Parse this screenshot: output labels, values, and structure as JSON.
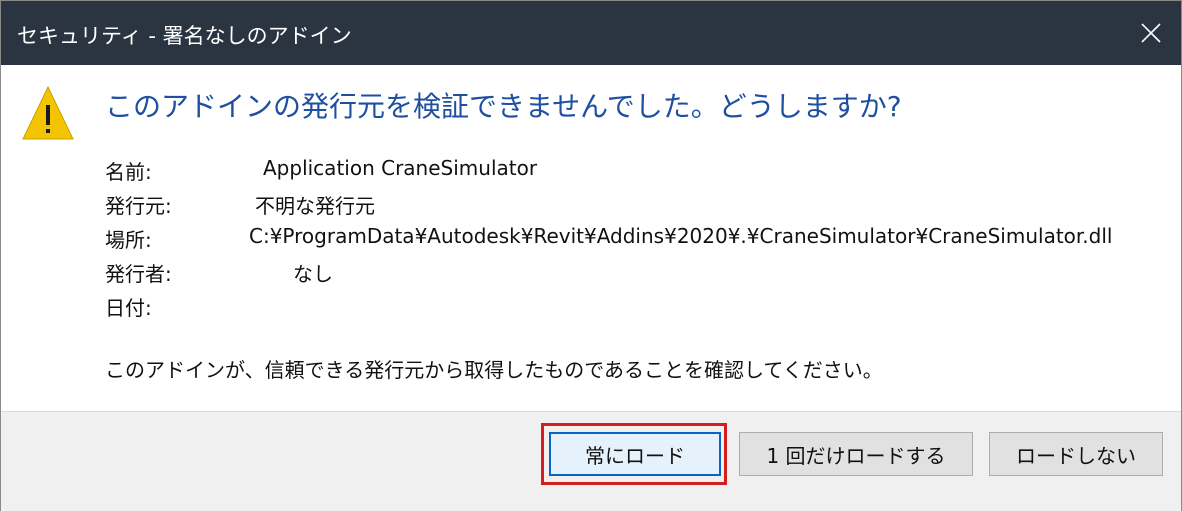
{
  "window": {
    "title": "セキュリティ - 署名なしのアドイン",
    "close_icon": "close-icon"
  },
  "warning_icon": "warning-triangle-icon",
  "headline": "このアドインの発行元を検証できませんでした。どうしますか?",
  "details": {
    "name_label": "名前:",
    "name_value": "Application CraneSimulator",
    "publisher_label": "発行元:",
    "publisher_value": "不明な発行元",
    "location_label": "場所:",
    "location_value": "C:¥ProgramData¥Autodesk¥Revit¥Addins¥2020¥.¥CraneSimulator¥CraneSimulator.dll",
    "issuer_label": "発行者:",
    "issuer_value": "なし",
    "date_label": "日付:",
    "date_value": ""
  },
  "confirm_text": "このアドインが、信頼できる発行元から取得したものであることを確認してください。",
  "buttons": {
    "always_load": "常にロード",
    "load_once": "1 回だけロードする",
    "do_not_load": "ロードしない"
  },
  "colors": {
    "titlebar": "#2b3441",
    "headline": "#1e4fa0",
    "highlight": "#d21e1e",
    "warning": "#f5c400"
  }
}
